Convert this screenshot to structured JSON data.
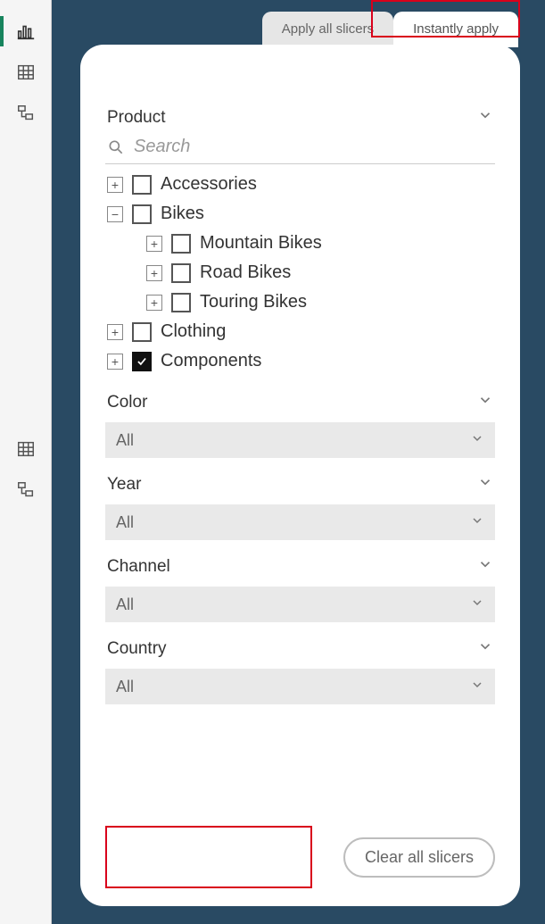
{
  "rail": {
    "items": [
      {
        "name": "report-view-icon",
        "active": true
      },
      {
        "name": "data-view-icon",
        "active": false
      },
      {
        "name": "model-view-icon",
        "active": false
      }
    ],
    "lower_items": [
      {
        "name": "data-view-icon-2"
      },
      {
        "name": "model-view-icon-2"
      }
    ]
  },
  "tabs": {
    "inactive_label": "Apply all slicers",
    "active_label": "Instantly apply"
  },
  "product_slicer": {
    "title": "Product",
    "search_placeholder": "Search",
    "tree": {
      "accessories": {
        "label": "Accessories",
        "expanded": false,
        "checked": false
      },
      "bikes": {
        "label": "Bikes",
        "expanded": true,
        "checked": false,
        "children": [
          {
            "label": "Mountain Bikes",
            "checked": false,
            "expanded": false
          },
          {
            "label": "Road Bikes",
            "checked": false,
            "expanded": false
          },
          {
            "label": "Touring Bikes",
            "checked": false,
            "expanded": false
          }
        ]
      },
      "clothing": {
        "label": "Clothing",
        "expanded": false,
        "checked": false
      },
      "components": {
        "label": "Components",
        "expanded": false,
        "checked": true
      }
    }
  },
  "slicers": [
    {
      "title": "Color",
      "value": "All"
    },
    {
      "title": "Year",
      "value": "All"
    },
    {
      "title": "Channel",
      "value": "All"
    },
    {
      "title": "Country",
      "value": "All"
    }
  ],
  "footer": {
    "clear_label": "Clear all slicers"
  },
  "highlight": {
    "tab_highlighted": true,
    "empty_apply_highlighted": true
  }
}
